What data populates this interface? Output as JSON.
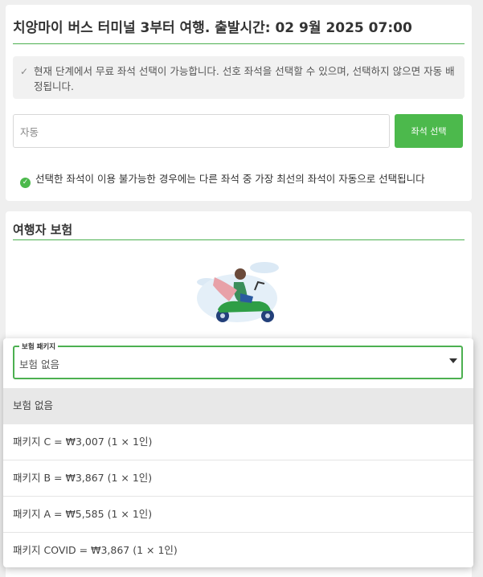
{
  "seat_section": {
    "trip_title": "치앙마이 버스 터미널 3부터 여행. 출발시간: 02 9월 2025 07:00",
    "info_text": "현재 단계에서 무료 좌석 선택이 가능합니다. 선호 좌석을 선택할 수 있으며, 선택하지 않으면 자동 배정됩니다.",
    "info_icon": "check-icon",
    "seat_input_value": "자동",
    "select_seat_button": "좌석 선택",
    "fallback_note": "선택한 좌석이 이용 불가능한 경우에는 다른 좌석 중 가장 최선의 좌석이 자동으로 선택됩니다",
    "note_icon": "check-circle-icon"
  },
  "insurance_section": {
    "title": "여행자 보험",
    "illustration": "scooter-rider-illustration",
    "package_select": {
      "label": "보험 패키지",
      "value": "보험 없음"
    },
    "options": [
      "보험 없음",
      "패키지 C = ₩3,007 (1 × 1인)",
      "패키지 B = ₩3,867 (1 × 1인)",
      "패키지 A = ₩5,585 (1 × 1인)",
      "패키지 COVID = ₩3,867 (1 × 1인)"
    ],
    "selected_option_index": 0
  },
  "colors": {
    "accent_green": "#4cb050",
    "button_green": "#4cb94c",
    "page_background": "#efefef",
    "info_background": "#f1f1f1",
    "selected_option_background": "#e8e8e8"
  }
}
